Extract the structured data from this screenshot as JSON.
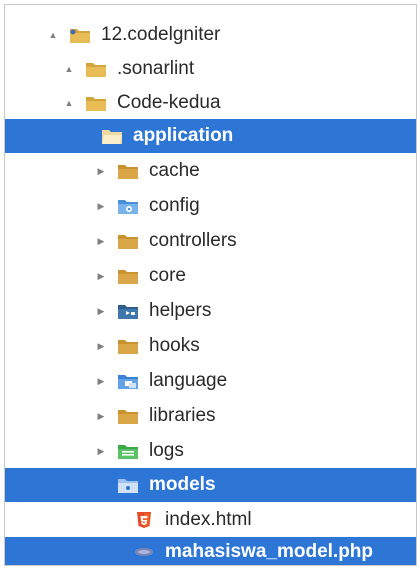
{
  "tree": {
    "items": [
      {
        "label": "12.codelgniter",
        "twisty": "▲",
        "icon": "project-folder-icon"
      },
      {
        "label": ".sonarlint",
        "twisty": "▲",
        "icon": "folder-icon"
      },
      {
        "label": "Code-kedua",
        "twisty": "▲",
        "icon": "folder-icon"
      },
      {
        "label": "application",
        "twisty": "",
        "icon": "folder-open-icon"
      },
      {
        "label": "cache",
        "twisty": "▶",
        "icon": "folder-icon"
      },
      {
        "label": "config",
        "twisty": "▶",
        "icon": "config-folder-icon"
      },
      {
        "label": "controllers",
        "twisty": "▶",
        "icon": "folder-icon"
      },
      {
        "label": "core",
        "twisty": "▶",
        "icon": "folder-icon"
      },
      {
        "label": "helpers",
        "twisty": "▶",
        "icon": "helpers-folder-icon"
      },
      {
        "label": "hooks",
        "twisty": "▶",
        "icon": "folder-icon"
      },
      {
        "label": "language",
        "twisty": "▶",
        "icon": "language-folder-icon"
      },
      {
        "label": "libraries",
        "twisty": "▶",
        "icon": "folder-icon"
      },
      {
        "label": "logs",
        "twisty": "▶",
        "icon": "logs-folder-icon"
      },
      {
        "label": "models",
        "twisty": "",
        "icon": "models-folder-icon"
      },
      {
        "label": "index.html",
        "twisty": "",
        "icon": "html5-file-icon"
      },
      {
        "label": "mahasiswa_model.php",
        "twisty": "",
        "icon": "php-file-icon"
      }
    ]
  },
  "colors": {
    "selection": "#2d76d6",
    "folder": "#d4a43c",
    "config": "#4a90d9",
    "helpers": "#2f5d8a",
    "language": "#3b82d6",
    "logs": "#39a845",
    "html5": "#e44d26"
  }
}
